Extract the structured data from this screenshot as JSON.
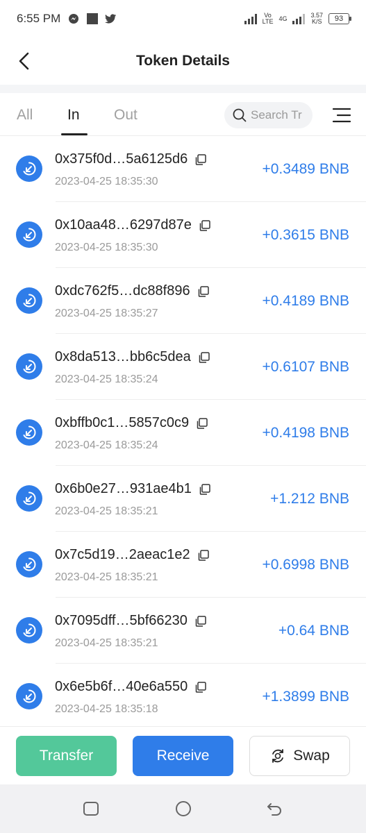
{
  "status_bar": {
    "time": "6:55 PM",
    "network_top": "Vo",
    "network_bottom": "LTE",
    "net_gen": "4G",
    "speed_top": "3.57",
    "speed_bottom": "K/S",
    "battery": "93"
  },
  "header": {
    "title": "Token Details"
  },
  "tabs": [
    {
      "label": "All",
      "active": false
    },
    {
      "label": "In",
      "active": true
    },
    {
      "label": "Out",
      "active": false
    }
  ],
  "search": {
    "placeholder": "Search Tr"
  },
  "transactions": [
    {
      "hash": "0x375f0d…5a6125d6",
      "time": "2023-04-25 18:35:30",
      "amount": "+0.3489 BNB"
    },
    {
      "hash": "0x10aa48…6297d87e",
      "time": "2023-04-25 18:35:30",
      "amount": "+0.3615 BNB"
    },
    {
      "hash": "0xdc762f5…dc88f896",
      "time": "2023-04-25 18:35:27",
      "amount": "+0.4189 BNB"
    },
    {
      "hash": "0x8da513…bb6c5dea",
      "time": "2023-04-25 18:35:24",
      "amount": "+0.6107 BNB"
    },
    {
      "hash": "0xbffb0c1…5857c0c9",
      "time": "2023-04-25 18:35:24",
      "amount": "+0.4198 BNB"
    },
    {
      "hash": "0x6b0e27…931ae4b1",
      "time": "2023-04-25 18:35:21",
      "amount": "+1.212 BNB"
    },
    {
      "hash": "0x7c5d19…2aeac1e2",
      "time": "2023-04-25 18:35:21",
      "amount": "+0.6998 BNB"
    },
    {
      "hash": "0x7095dff…5bf66230",
      "time": "2023-04-25 18:35:21",
      "amount": "+0.64 BNB"
    },
    {
      "hash": "0x6e5b6f…40e6a550",
      "time": "2023-04-25 18:35:18",
      "amount": "+1.3899 BNB"
    }
  ],
  "actions": {
    "transfer": "Transfer",
    "receive": "Receive",
    "swap": "Swap"
  },
  "colors": {
    "accent": "#2f7de9",
    "transfer": "#53c89a"
  }
}
